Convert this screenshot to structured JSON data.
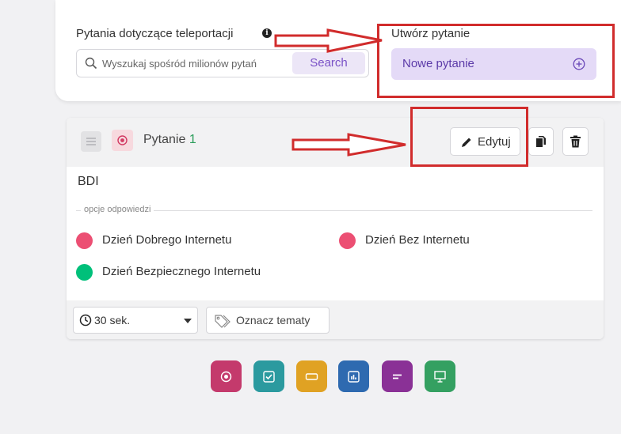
{
  "header": {
    "teleport_label": "Pytania dotyczące teleportacji",
    "search_placeholder": "Wyszukaj spośród milionów pytań",
    "search_button": "Search",
    "create_label": "Utwórz pytanie",
    "new_question_label": "Nowe pytanie"
  },
  "question": {
    "title_prefix": "Pytanie",
    "number": "1",
    "edit_label": "Edytuj",
    "text": "BDI",
    "options_label": "opcje odpowiedzi",
    "options": [
      {
        "text": "Dzień Dobrego Internetu",
        "color": "#ec4f73",
        "correct": false
      },
      {
        "text": "Dzień Bez Internetu",
        "color": "#ec4f73",
        "correct": false
      },
      {
        "text": "Dzień Bezpiecznego Internetu",
        "color": "#00c07a",
        "correct": true
      }
    ],
    "time": "30 sek.",
    "tag_label": "Oznacz tematy"
  },
  "question_types": [
    {
      "icon": "radio-icon",
      "color": "#c43a6c"
    },
    {
      "icon": "checkbox-icon",
      "color": "#2b9a9f"
    },
    {
      "icon": "text-field-icon",
      "color": "#e0a223"
    },
    {
      "icon": "poll-icon",
      "color": "#2e6ab0"
    },
    {
      "icon": "open-ended-icon",
      "color": "#8a3196"
    },
    {
      "icon": "slide-icon",
      "color": "#34a061"
    }
  ],
  "annotation_color": "#d12c2c"
}
